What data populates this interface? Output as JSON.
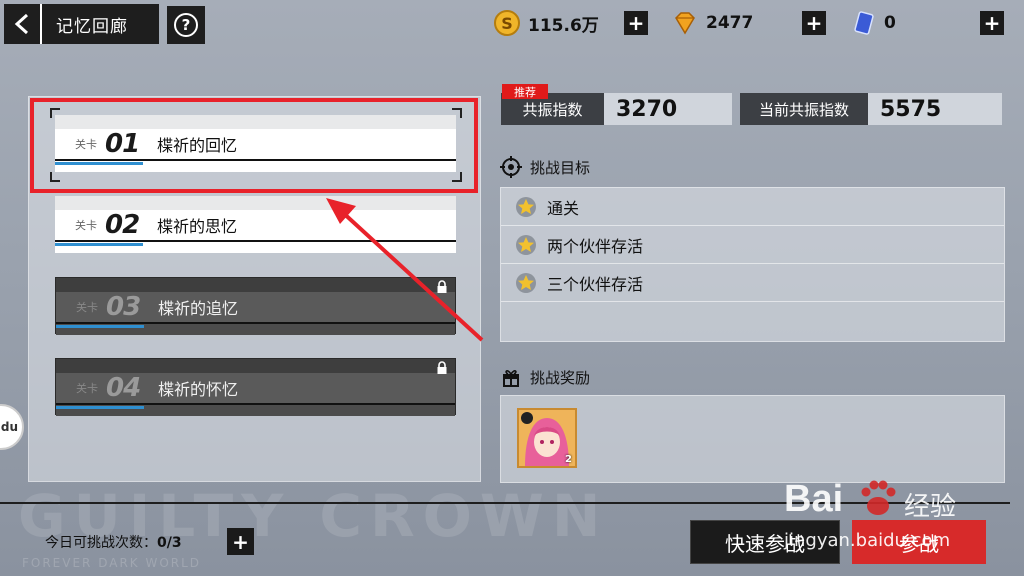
{
  "header": {
    "title": "记忆回廊",
    "help_label": "?",
    "resources": [
      {
        "icon": "gold-coin-icon",
        "value": "115.6万"
      },
      {
        "icon": "diamond-icon",
        "value": "2477"
      },
      {
        "icon": "ticket-card-icon",
        "value": "0"
      }
    ],
    "plus_label": "+"
  },
  "stages": [
    {
      "tag": "关卡",
      "number": "01",
      "name": "楪祈的回忆",
      "locked": false
    },
    {
      "tag": "关卡",
      "number": "02",
      "name": "楪祈的思忆",
      "locked": false
    },
    {
      "tag": "关卡",
      "number": "03",
      "name": "楪祈的追忆",
      "locked": true
    },
    {
      "tag": "关卡",
      "number": "04",
      "name": "楪祈的怀忆",
      "locked": true
    }
  ],
  "resonance": {
    "badge": "推荐",
    "recommended_label": "共振指数",
    "recommended_value": "3270",
    "current_label": "当前共振指数",
    "current_value": "5575"
  },
  "goals": {
    "title": "挑战目标",
    "items": [
      "通关",
      "两个伙伴存活",
      "三个伙伴存活"
    ]
  },
  "rewards": {
    "title": "挑战奖励",
    "items": [
      {
        "icon": "character-portrait-icon",
        "count": "2"
      }
    ]
  },
  "footer": {
    "attempts_label": "今日可挑战次数：",
    "attempts_value": "0/3",
    "quick_battle": "快速参战",
    "join_battle": "参战",
    "logo_text": "GUILTY CROWN",
    "logo_sub": "FOREVER DARK WORLD",
    "side_badge": "du"
  },
  "watermark": {
    "brand": "Bai",
    "brand_suffix": "经验",
    "url": "jingyan.baidu.com"
  },
  "colors": {
    "highlight": "#e8222a",
    "accent_blue": "#2f8fd0",
    "join_red": "#d72a2a"
  }
}
